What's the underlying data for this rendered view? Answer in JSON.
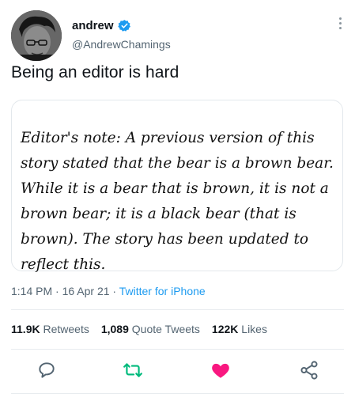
{
  "author": {
    "name": "andrew",
    "handle": "@AndrewChamings"
  },
  "tweet": {
    "text": "Being an editor is hard"
  },
  "card": {
    "text": "Editor's note: A previous version of this story stated that the bear is a brown bear. While it is a bear that is brown, it is not a brown bear; it is a black bear (that is brown). The story has been updated to reflect this."
  },
  "meta": {
    "time": "1:14 PM",
    "sep1": "·",
    "date": "16 Apr 21",
    "sep2": "·",
    "source": "Twitter for iPhone"
  },
  "stats": {
    "retweets_count": "11.9K",
    "retweets_label": "Retweets",
    "quotes_count": "1,089",
    "quotes_label": "Quote Tweets",
    "likes_count": "122K",
    "likes_label": "Likes"
  },
  "actions": {
    "reply_icon": "reply-icon",
    "retweet_icon": "retweet-icon",
    "like_icon": "heart-icon",
    "share_icon": "share-icon"
  },
  "colors": {
    "accent": "#1d9bf0",
    "retweet": "#00ba7c",
    "like": "#f91880",
    "muted": "#536471"
  }
}
